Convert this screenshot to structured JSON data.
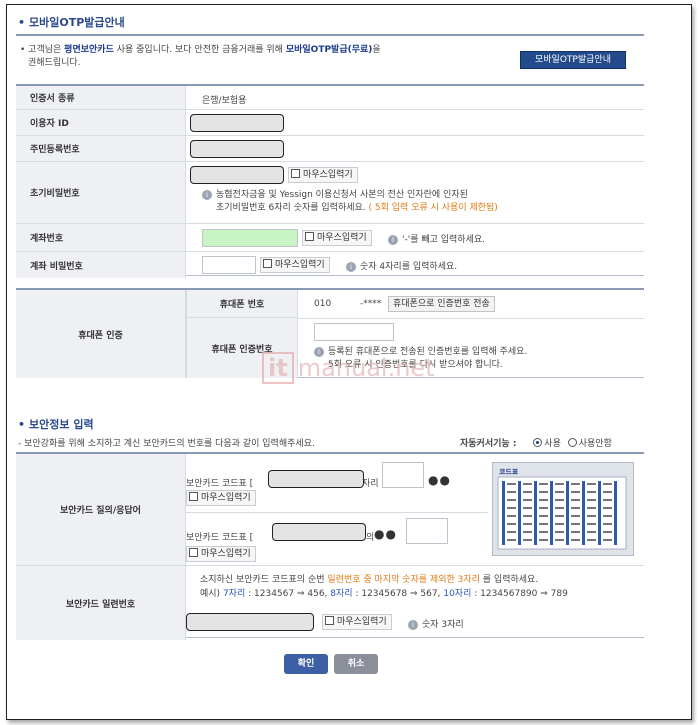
{
  "otp": {
    "title": "모바일OTP발급안내",
    "notice_1": "고객님은",
    "notice_card": "평면보안카드",
    "notice_2": "사용 중입니다. 보다 안전한 금융거래를 위해",
    "notice_otp": "모바일OTP발급(무료)",
    "notice_3": "을",
    "notice_4": "권해드립니다.",
    "guide_button": "모바일OTP발급안내"
  },
  "form": {
    "cert_type_label": "인증서 종류",
    "cert_type_value": "은행/보험용",
    "user_id_label": "이용자 ID",
    "resident_label": "주민등록번호",
    "init_pw_label": "초기비밀번호",
    "mouse_input": "마우스입력기",
    "init_pw_help_1": "농협전자금융 및 Yessign 이용신청서 사본의 전산 인자란에 인자된",
    "init_pw_help_2": "초기비밀번호 6자리 숫자를 입력하세요.",
    "init_pw_warn": "( 5회 입력 오류 시 사용이 제한됨)",
    "account_label": "계좌번호",
    "account_help": "'-'를 빼고 입력하세요.",
    "account_pw_label": "계좌 비밀번호",
    "account_pw_help": "숫자 4자리를 입력하세요."
  },
  "phone": {
    "auth_label": "휴대폰 인증",
    "number_label": "휴대폰 번호",
    "prefix": "010",
    "masked": "-****",
    "send_button": "휴대폰으로 인증번호 전송",
    "code_label": "휴대폰 인증번호",
    "help_1": "등록된 휴대폰으로 전송된 인증번호를 입력해 주세요.",
    "help_2": "5회 오류 시 인증번호를 다시 받으셔야 합니다."
  },
  "security": {
    "title": "보안정보 입력",
    "notice": "보안강화를 위해 소지하고 계신 보안카드의 번호를 다음과 같이 입력해주세요.",
    "auto_cursor_label": "자동커서기능 :",
    "opt_use": "사용",
    "opt_nouse": "사용안함",
    "qa_label": "보안카드 질의/응답어",
    "code_prefix": "보안카드 코드표 [",
    "code_suffix_1": "자리",
    "code_suffix_2": "의",
    "dots": "●●",
    "card_title": "코드표",
    "serial_label": "보안카드 일련번호",
    "serial_help_1": "소지하신 보안카드 코드표의 순번",
    "serial_help_orange": "일련번호 중 마지막 숫자를 제외한 3자리",
    "serial_help_2": "를 입력하세요.",
    "ex_prefix": "예시)",
    "ex_7": "7자리",
    "ex_7_val": ": 1234567 ⇒ 456,",
    "ex_8": "8자리",
    "ex_8_val": ": 12345678 ⇒ 567,",
    "ex_10": "10자리",
    "ex_10_val": ": 1234567890 ⇒ 789",
    "serial_digits": "숫자 3자리"
  },
  "actions": {
    "confirm": "확인",
    "cancel": "취소"
  },
  "watermark": {
    "it": "it",
    "text": "manual.net"
  }
}
